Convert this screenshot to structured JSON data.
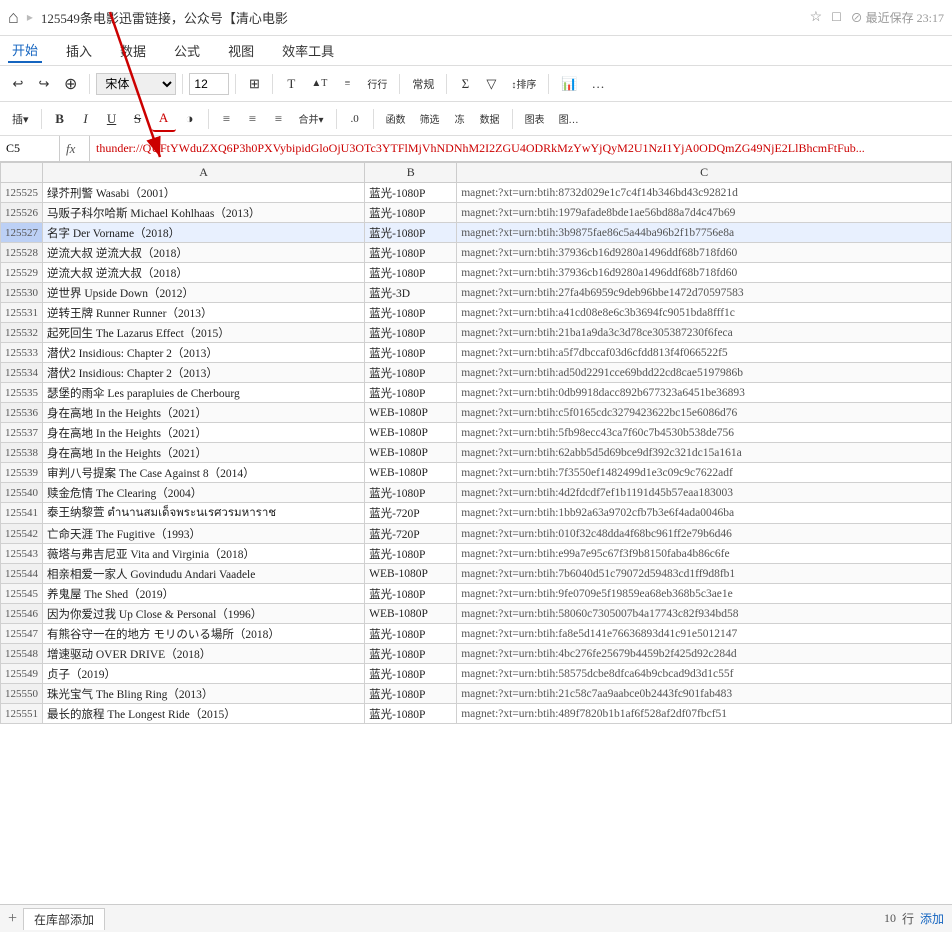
{
  "titleBar": {
    "homeIcon": "⌂",
    "title": "125549条电影迅雷链接，公众号【清心电影",
    "starIcon": "☆",
    "pinIcon": "□",
    "saveInfo": "⊘ 最近保存 23:17"
  },
  "menuBar": {
    "items": [
      "开始",
      "插入",
      "数据",
      "公式",
      "视图",
      "效率工具"
    ]
  },
  "formulaBar": {
    "cellRef": "C5",
    "content": "thunder://QUFtYWduZXQ6P3h0PXVybipidGloOjU3OTc3YTFlMjVhNDNhM2I2ZGU4ODRkMzYwYjQyM2U1NzI1YjA0ODQmZG49NjE2LlBhcmFtFub..."
  },
  "columns": {
    "headers": [
      "",
      "A",
      "B",
      "C"
    ]
  },
  "rows": [
    {
      "id": "125525",
      "movieName": "绿芥刑警 Wasabi（2001）",
      "quality": "蓝光-1080P",
      "magnet": "magnet:?xt=urn:btih:8732d029e1c7c4f14b346bd43c92821d"
    },
    {
      "id": "125526",
      "movieName": "马贩子科尔哈斯 Michael Kohlhaas（2013）",
      "quality": "蓝光-1080P",
      "magnet": "magnet:?xt=urn:btih:1979afade8bde1ae56bd88a7d4c47b69"
    },
    {
      "id": "125527",
      "movieName": "名字 Der Vorname（2018）",
      "quality": "蓝光-1080P",
      "magnet": "magnet:?xt=urn:btih:3b9875fae86c5a44ba96b2f1b7756e8a"
    },
    {
      "id": "125528",
      "movieName": "逆流大叔 逆流大叔（2018）",
      "quality": "蓝光-1080P",
      "magnet": "magnet:?xt=urn:btih:37936cb16d9280a1496ddf68b718fd60"
    },
    {
      "id": "125529",
      "movieName": "逆流大叔 逆流大叔（2018）",
      "quality": "蓝光-1080P",
      "magnet": "magnet:?xt=urn:btih:37936cb16d9280a1496ddf68b718fd60"
    },
    {
      "id": "125530",
      "movieName": "逆世界 Upside Down（2012）",
      "quality": "蓝光-3D",
      "magnet": "magnet:?xt=urn:btih:27fa4b6959c9deb96bbe1472d70597583"
    },
    {
      "id": "125531",
      "movieName": "逆转王牌 Runner Runner（2013）",
      "quality": "蓝光-1080P",
      "magnet": "magnet:?xt=urn:btih:a41cd08e8e6c3b3694fc9051bda8fff1c"
    },
    {
      "id": "125532",
      "movieName": "起死回生 The Lazarus Effect（2015）",
      "quality": "蓝光-1080P",
      "magnet": "magnet:?xt=urn:btih:21ba1a9da3c3d78ce305387230f6feca"
    },
    {
      "id": "125533",
      "movieName": "潜伏2 Insidious: Chapter 2（2013）",
      "quality": "蓝光-1080P",
      "magnet": "magnet:?xt=urn:btih:a5f7dbccaf03d6cfdd813f4f066522f5"
    },
    {
      "id": "125534",
      "movieName": "潜伏2 Insidious: Chapter 2（2013）",
      "quality": "蓝光-1080P",
      "magnet": "magnet:?xt=urn:btih:ad50d2291cce69bdd22cd8cae5197986b"
    },
    {
      "id": "125535",
      "movieName": "瑟堡的雨伞 Les parapluies de Cherbourg",
      "quality": "蓝光-1080P",
      "magnet": "magnet:?xt=urn:btih:0db9918dacc892b677323a6451be36893"
    },
    {
      "id": "125536",
      "movieName": "身在高地 In the Heights（2021）",
      "quality": "WEB-1080P",
      "magnet": "magnet:?xt=urn:btih:c5f0165cdc3279423622bc15e6086d76"
    },
    {
      "id": "125537",
      "movieName": "身在高地 In the Heights（2021）",
      "quality": "WEB-1080P",
      "magnet": "magnet:?xt=urn:btih:5fb98ecc43ca7f60c7b4530b538de756"
    },
    {
      "id": "125538",
      "movieName": "身在高地 In the Heights（2021）",
      "quality": "WEB-1080P",
      "magnet": "magnet:?xt=urn:btih:62abb5d5d69bce9df392c321dc15a161a"
    },
    {
      "id": "125539",
      "movieName": "审判八号提案 The Case Against 8（2014）",
      "quality": "WEB-1080P",
      "magnet": "magnet:?xt=urn:btih:7f3550ef1482499d1e3c09c9c7622adf"
    },
    {
      "id": "125540",
      "movieName": "赎金危情 The Clearing（2004）",
      "quality": "蓝光-1080P",
      "magnet": "magnet:?xt=urn:btih:4d2fdcdf7ef1b1191d45b57eaa183003"
    },
    {
      "id": "125541",
      "movieName": "泰王纳黎萱 ตำนานสมเด็จพระนเรศวรมหาราช",
      "quality": "蓝光-720P",
      "magnet": "magnet:?xt=urn:btih:1bb92a63a9702cfb7b3e6f4ada0046ba"
    },
    {
      "id": "125542",
      "movieName": "亡命天涯 The Fugitive（1993）",
      "quality": "蓝光-720P",
      "magnet": "magnet:?xt=urn:btih:010f32c48dda4f68bc961ff2e79b6d46"
    },
    {
      "id": "125543",
      "movieName": "薇塔与弗吉尼亚 Vita and Virginia（2018）",
      "quality": "蓝光-1080P",
      "magnet": "magnet:?xt=urn:btih:e99a7e95c67f3f9b8150faba4b86c6fe"
    },
    {
      "id": "125544",
      "movieName": "相亲相爱一家人 Govindudu Andari Vaadele",
      "quality": "WEB-1080P",
      "magnet": "magnet:?xt=urn:btih:7b6040d51c79072d59483cd1ff9d8fb1"
    },
    {
      "id": "125545",
      "movieName": "养鬼屋 The Shed（2019）",
      "quality": "蓝光-1080P",
      "magnet": "magnet:?xt=urn:btih:9fe0709e5f19859ea68eb368b5c3ae1e"
    },
    {
      "id": "125546",
      "movieName": "因为你爱过我 Up Close & Personal（1996）",
      "quality": "WEB-1080P",
      "magnet": "magnet:?xt=urn:btih:58060c7305007b4a17743c82f934bd58"
    },
    {
      "id": "125547",
      "movieName": "有熊谷守一在的地方 モリのいる場所（2018）",
      "quality": "蓝光-1080P",
      "magnet": "magnet:?xt=urn:btih:fa8e5d141e76636893d41c91e5012147"
    },
    {
      "id": "125548",
      "movieName": "增速驱动 OVER DRIVE（2018）",
      "quality": "蓝光-1080P",
      "magnet": "magnet:?xt=urn:btih:4bc276fe25679b4459b2f425d92c284d"
    },
    {
      "id": "125549",
      "movieName": "贞子（2019）",
      "quality": "蓝光-1080P",
      "magnet": "magnet:?xt=urn:btih:58575dcbe8dfca64b9cbcad9d3d1c55f"
    },
    {
      "id": "125550",
      "movieName": "珠光宝气 The Bling Ring（2013）",
      "quality": "蓝光-1080P",
      "magnet": "magnet:?xt=urn:btih:21c58c7aa9aabce0b2443fc901fab483"
    },
    {
      "id": "125551",
      "movieName": "最长的旅程 The Longest Ride（2015）",
      "quality": "蓝光-1080P",
      "magnet": "magnet:?xt=urn:btih:489f7820b1b1af6f528af2df07fbcf51"
    }
  ],
  "bottomBar": {
    "addIcon": "+",
    "sheetName": "在库部添加",
    "rowLabel": "行",
    "addLabel": "添加",
    "rowCount": "10"
  }
}
